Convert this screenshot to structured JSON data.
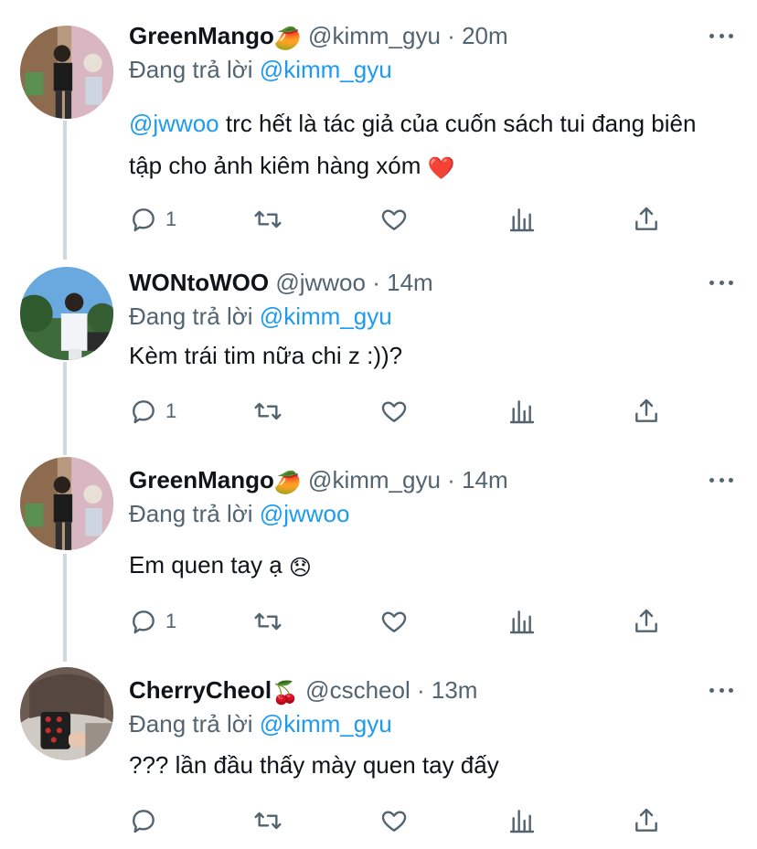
{
  "colors": {
    "text": "#0f1419",
    "secondary": "#536471",
    "accent": "#1d9bf0",
    "thread": "#cfd9de",
    "heart": "#e0245e"
  },
  "tweets": [
    {
      "name": "GreenMango",
      "name_emoji": "🥭",
      "handle": "@kimm_gyu",
      "dot": "·",
      "time": "20m",
      "reply_prefix": "Đang trả lời",
      "reply_to": "@kimm_gyu",
      "body_mention": "@jwwoo",
      "body": " trc hết là tác giả của cuốn sách tui đang biên tập cho ảnh kiêm hàng xóm ",
      "body_emoji": "❤️",
      "actions": {
        "reply_count": "1",
        "retweet_count": "",
        "like_count": ""
      },
      "avatar": "photo of person in black shirt in front of colorful mural"
    },
    {
      "name": "WONtoWOO",
      "name_emoji": "",
      "handle": "@jwwoo",
      "dot": "·",
      "time": "14m",
      "reply_prefix": "Đang trả lời",
      "reply_to": "@kimm_gyu",
      "body_mention": "",
      "body": "Kèm trái tim nữa chi z :))?",
      "body_emoji": "",
      "actions": {
        "reply_count": "1",
        "retweet_count": "",
        "like_count": ""
      },
      "avatar": "photo of person in white shirt under blue sky with trees"
    },
    {
      "name": "GreenMango",
      "name_emoji": "🥭",
      "handle": "@kimm_gyu",
      "dot": "·",
      "time": "14m",
      "reply_prefix": "Đang trả lời",
      "reply_to": "@jwwoo",
      "body_mention": "",
      "body": "Em quen tay ạ ",
      "body_emoji": "😞",
      "actions": {
        "reply_count": "1",
        "retweet_count": "",
        "like_count": ""
      },
      "avatar": "photo of person in black shirt in front of colorful mural"
    },
    {
      "name": "CherryCheol",
      "name_emoji": "🍒",
      "handle": "@cscheol",
      "dot": "·",
      "time": "13m",
      "reply_prefix": "Đang trả lời",
      "reply_to": "@kimm_gyu",
      "body_mention": "",
      "body": "??? lần đầu thấy mày quen tay đấy",
      "body_emoji": "",
      "actions": {
        "reply_count": "",
        "retweet_count": "",
        "like_count": ""
      },
      "avatar": "photo of person taking mirror selfie with phone"
    }
  ],
  "icons": [
    "reply-icon",
    "retweet-icon",
    "like-icon",
    "analytics-icon",
    "share-icon",
    "more-icon"
  ]
}
